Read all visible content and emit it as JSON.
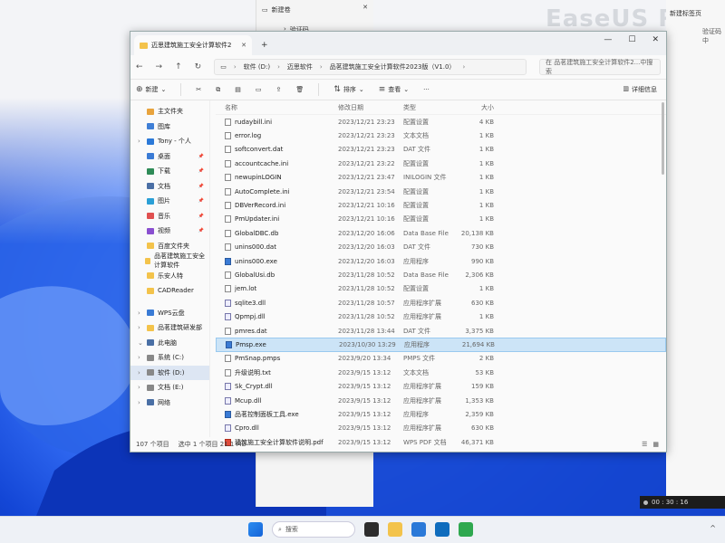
{
  "background_window": {
    "tab_title": "新建卷",
    "path_label": "验证码"
  },
  "watermark": "EaseUS Rec",
  "right_panel": {
    "tab_title": "新建标签页",
    "hint": "验证码中"
  },
  "recorder": {
    "time": "00 : 30 : 16"
  },
  "window": {
    "tab_title": "迈思建筑施工安全计算软件2",
    "address": [
      "软件 (D:)",
      "迈思软件",
      "品茗建筑施工安全计算软件2023版（V1.0）"
    ],
    "search_placeholder": "在 品茗建筑施工安全计算软件2...中搜索",
    "toolbar": {
      "new": "新建",
      "sort": "排序",
      "view": "查看",
      "details": "详细信息"
    },
    "columns": {
      "name": "名称",
      "date": "修改日期",
      "type": "类型",
      "size": "大小"
    },
    "sidebar": [
      {
        "label": "主文件夹",
        "color": "#e8a33d",
        "chev": ""
      },
      {
        "label": "图库",
        "color": "#3f7fd6",
        "chev": ""
      },
      {
        "label": "Tony - 个人",
        "color": "#2b79d8",
        "chev": "›"
      },
      {
        "label": "桌面",
        "color": "#3a7bd5",
        "pin": true,
        "chev": ""
      },
      {
        "label": "下载",
        "color": "#2e8b57",
        "pin": true,
        "chev": ""
      },
      {
        "label": "文档",
        "color": "#4a6fa5",
        "pin": true,
        "chev": ""
      },
      {
        "label": "图片",
        "color": "#2a9fd6",
        "pin": true,
        "chev": ""
      },
      {
        "label": "音乐",
        "color": "#e05050",
        "pin": true,
        "chev": ""
      },
      {
        "label": "视频",
        "color": "#8a4fd0",
        "pin": true,
        "chev": ""
      },
      {
        "label": "百度文件夹",
        "color": "#f3c34b",
        "chev": ""
      },
      {
        "label": "品茗建筑施工安全计算软件",
        "color": "#f3c34b",
        "chev": ""
      },
      {
        "label": "乐安人特",
        "color": "#f3c34b",
        "chev": ""
      },
      {
        "label": "CADReader",
        "color": "#f3c34b",
        "chev": ""
      },
      {
        "gap": true
      },
      {
        "label": "WPS云盘",
        "color": "#3a7bd5",
        "chev": "›"
      },
      {
        "label": "品茗建筑研发部",
        "color": "#f3c34b",
        "chev": "›"
      },
      {
        "label": "此电脑",
        "color": "#4a6fa5",
        "chev": "⌄"
      },
      {
        "label": "系统 (C:)",
        "color": "#888",
        "chev": "›"
      },
      {
        "label": "软件 (D:)",
        "color": "#888",
        "chev": "›",
        "selected": true
      },
      {
        "label": "文档 (E:)",
        "color": "#888",
        "chev": "›"
      },
      {
        "label": "网络",
        "color": "#4a6fa5",
        "chev": "›"
      }
    ],
    "files": [
      {
        "name": "rudaybill.ini",
        "date": "2023/12/21 23:23",
        "type": "配置设置",
        "size": "4 KB",
        "icon": "file"
      },
      {
        "name": "error.log",
        "date": "2023/12/21 23:23",
        "type": "文本文档",
        "size": "1 KB",
        "icon": "file"
      },
      {
        "name": "softconvert.dat",
        "date": "2023/12/21 23:23",
        "type": "DAT 文件",
        "size": "1 KB",
        "icon": "file"
      },
      {
        "name": "accountcache.ini",
        "date": "2023/12/21 23:22",
        "type": "配置设置",
        "size": "1 KB",
        "icon": "file"
      },
      {
        "name": "newupinLOGIN",
        "date": "2023/12/21 23:47",
        "type": "INILOGIN 文件",
        "size": "1 KB",
        "icon": "file"
      },
      {
        "name": "AutoComplete.ini",
        "date": "2023/12/21 23:54",
        "type": "配置设置",
        "size": "1 KB",
        "icon": "file"
      },
      {
        "name": "DBVerRecord.ini",
        "date": "2023/12/21 10:16",
        "type": "配置设置",
        "size": "1 KB",
        "icon": "file"
      },
      {
        "name": "PmUpdater.ini",
        "date": "2023/12/21 10:16",
        "type": "配置设置",
        "size": "1 KB",
        "icon": "file"
      },
      {
        "name": "GlobalDBC.db",
        "date": "2023/12/20 16:06",
        "type": "Data Base File",
        "size": "20,138 KB",
        "icon": "file"
      },
      {
        "name": "unins000.dat",
        "date": "2023/12/20 16:03",
        "type": "DAT 文件",
        "size": "730 KB",
        "icon": "file"
      },
      {
        "name": "unins000.exe",
        "date": "2023/12/20 16:03",
        "type": "应用程序",
        "size": "990 KB",
        "icon": "exe"
      },
      {
        "name": "GlobalUsi.db",
        "date": "2023/11/28 10:52",
        "type": "Data Base File",
        "size": "2,306 KB",
        "icon": "file"
      },
      {
        "name": "jem.lot",
        "date": "2023/11/28 10:52",
        "type": "配置设置",
        "size": "1 KB",
        "icon": "file"
      },
      {
        "name": "sqlite3.dll",
        "date": "2023/11/28 10:57",
        "type": "应用程序扩展",
        "size": "630 KB",
        "icon": "dll"
      },
      {
        "name": "Qpmpj.dll",
        "date": "2023/11/28 10:52",
        "type": "应用程序扩展",
        "size": "1 KB",
        "icon": "dll"
      },
      {
        "name": "pmres.dat",
        "date": "2023/11/28 13:44",
        "type": "DAT 文件",
        "size": "3,375 KB",
        "icon": "file"
      },
      {
        "name": "Pmsp.exe",
        "date": "2023/10/30 13:29",
        "type": "应用程序",
        "size": "21,694 KB",
        "icon": "exe",
        "selected": true
      },
      {
        "name": "PmSnap.pmps",
        "date": "2023/9/20 13:34",
        "type": "PMPS 文件",
        "size": "2 KB",
        "icon": "file"
      },
      {
        "name": "升级说明.txt",
        "date": "2023/9/15 13:12",
        "type": "文本文档",
        "size": "53 KB",
        "icon": "file"
      },
      {
        "name": "Sk_Crypt.dll",
        "date": "2023/9/15 13:12",
        "type": "应用程序扩展",
        "size": "159 KB",
        "icon": "dll"
      },
      {
        "name": "Mcup.dll",
        "date": "2023/9/15 13:12",
        "type": "应用程序扩展",
        "size": "1,353 KB",
        "icon": "dll"
      },
      {
        "name": "品茗控制面板工具.exe",
        "date": "2023/9/15 13:12",
        "type": "应用程序",
        "size": "2,359 KB",
        "icon": "exe"
      },
      {
        "name": "Cpro.dll",
        "date": "2023/9/15 13:12",
        "type": "应用程序扩展",
        "size": "630 KB",
        "icon": "dll"
      },
      {
        "name": "建筑施工安全计算软件说明.pdf",
        "date": "2023/9/15 13:12",
        "type": "WPS PDF 文档",
        "size": "46,371 KB",
        "icon": "pdf"
      }
    ],
    "status": {
      "count": "107 个项目",
      "selected": "选中 1 个项目  21.1 MB"
    }
  },
  "taskbar": {
    "search_placeholder": "搜索"
  }
}
